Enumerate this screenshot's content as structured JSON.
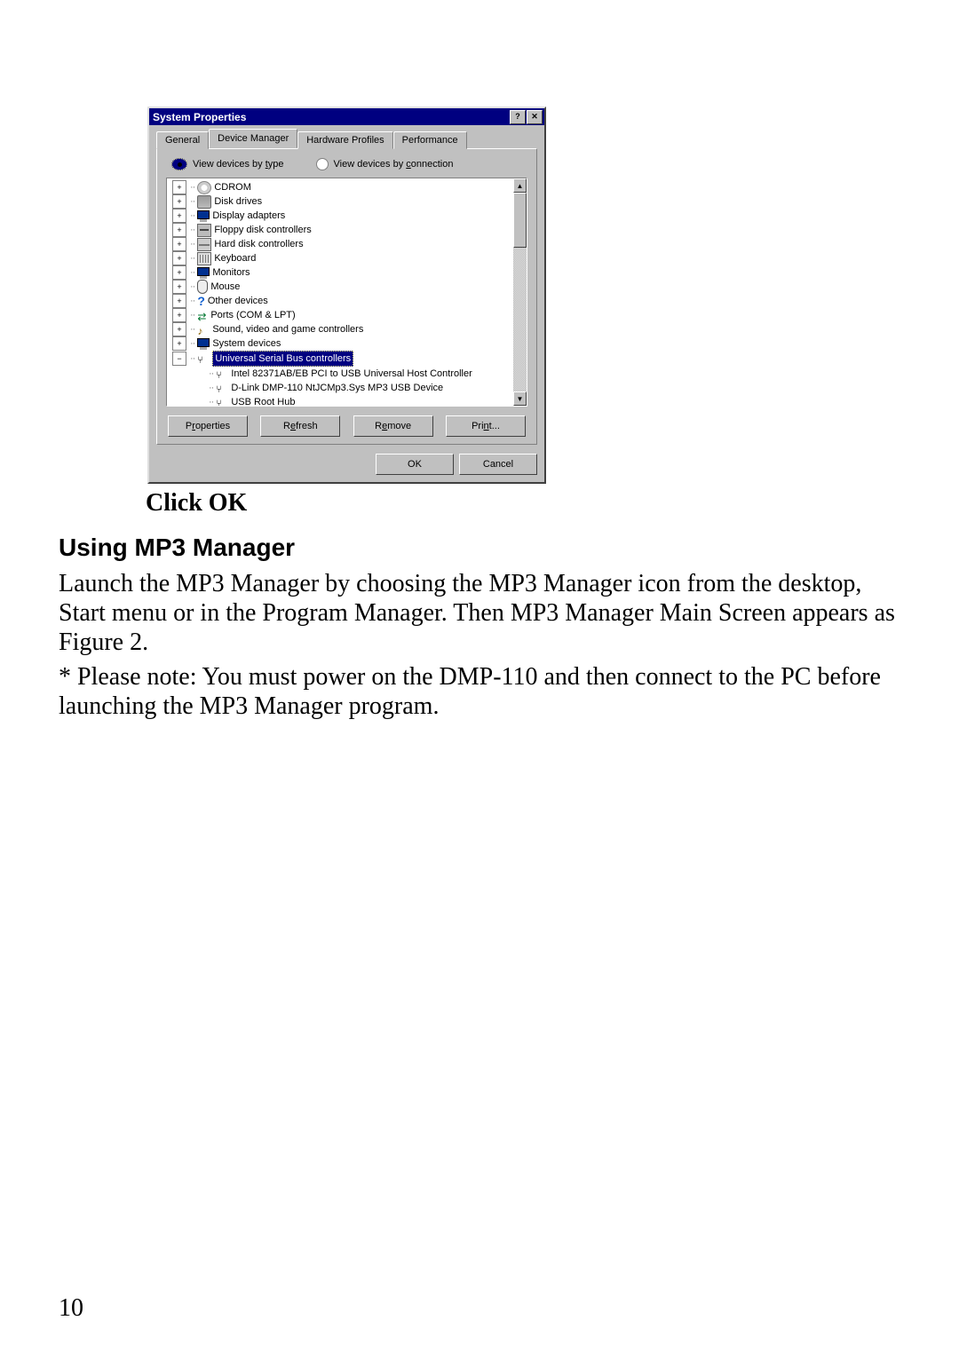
{
  "dialog": {
    "title": "System Properties",
    "help_btn": "?",
    "close_btn": "✕",
    "tabs": [
      "General",
      "Device Manager",
      "Hardware Profiles",
      "Performance"
    ],
    "active_tab_index": 1,
    "radio1_pre": "View devices by ",
    "radio1_ul": "t",
    "radio1_post": "ype",
    "radio2_pre": "View devices by ",
    "radio2_ul": "c",
    "radio2_post": "onnection",
    "tree": [
      {
        "expand": "+",
        "icon": "cd",
        "label": "CDROM"
      },
      {
        "expand": "+",
        "icon": "disk",
        "label": "Disk drives"
      },
      {
        "expand": "+",
        "icon": "mon",
        "label": "Display adapters"
      },
      {
        "expand": "+",
        "icon": "fdc",
        "label": "Floppy disk controllers"
      },
      {
        "expand": "+",
        "icon": "hdc",
        "label": "Hard disk controllers"
      },
      {
        "expand": "+",
        "icon": "kbd",
        "label": "Keyboard"
      },
      {
        "expand": "+",
        "icon": "mon",
        "label": "Monitors"
      },
      {
        "expand": "+",
        "icon": "mouse",
        "label": "Mouse"
      },
      {
        "expand": "+",
        "icon": "q",
        "label": "Other devices"
      },
      {
        "expand": "+",
        "icon": "port",
        "label": "Ports (COM & LPT)"
      },
      {
        "expand": "+",
        "icon": "snd",
        "label": "Sound, video and game controllers"
      },
      {
        "expand": "+",
        "icon": "mon",
        "label": "System devices"
      },
      {
        "expand": "−",
        "icon": "usb",
        "label": "Universal Serial Bus controllers",
        "selected": true,
        "children": [
          {
            "icon": "usb",
            "label": "Intel 82371AB/EB PCI to USB Universal Host Controller"
          },
          {
            "icon": "usb",
            "label": "D-Link DMP-110  NtJCMp3.Sys  MP3 USB Device"
          },
          {
            "icon": "usb",
            "label": "USB Root Hub"
          }
        ]
      }
    ],
    "buttons": {
      "properties_pre": "P",
      "properties_ul": "r",
      "properties_post": "operties",
      "refresh_pre": "R",
      "refresh_ul": "e",
      "refresh_post": "fresh",
      "remove_pre": "R",
      "remove_ul": "e",
      "remove_post": "move",
      "remove_text": "Remove",
      "print_pre": "Pri",
      "print_ul": "n",
      "print_post": "t...",
      "ok": "OK",
      "cancel": "Cancel"
    }
  },
  "doc": {
    "caption": "Click OK",
    "heading": "Using MP3 Manager",
    "para1": "Launch the MP3 Manager by choosing the MP3 Manager icon from the desktop, Start menu or in the Program Manager.  Then MP3 Manager Main Screen appears as Figure 2.",
    "para2": "* Please note: You must power on the DMP-110 and then connect to the PC before launching the MP3 Manager program.",
    "page_number": "10"
  }
}
